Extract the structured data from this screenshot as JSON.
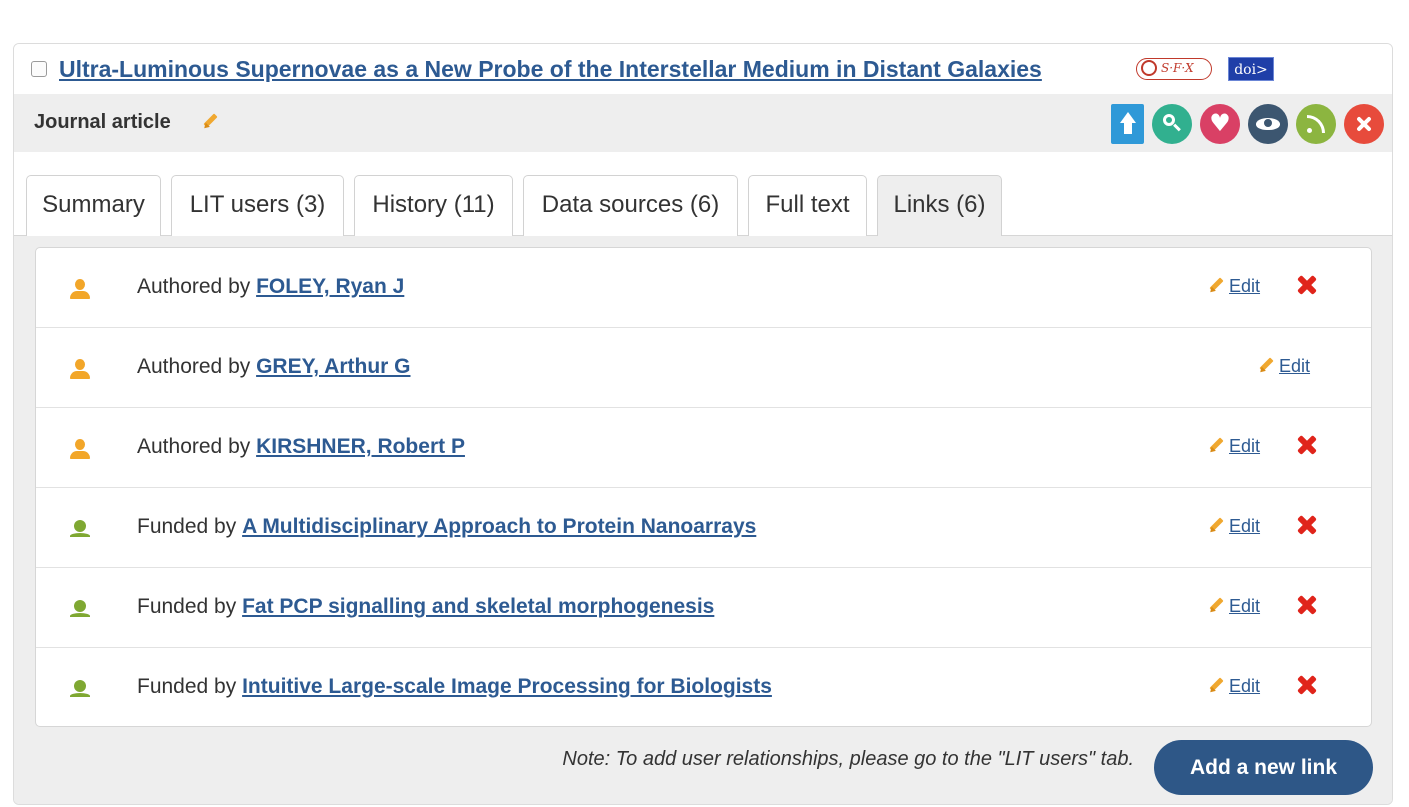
{
  "record": {
    "title": "Ultra-Luminous Supernovae as a New Probe of the Interstellar Medium in Distant Galaxies",
    "sfx_label": "S·F·X",
    "doi_label": "doi>",
    "type_label": "Journal article"
  },
  "actions": [
    {
      "icon": "upload-icon",
      "color": "#2f99d8"
    },
    {
      "icon": "search-icon",
      "color": "#31b08f"
    },
    {
      "icon": "heart-icon",
      "color": "#d94065"
    },
    {
      "icon": "eye-icon",
      "color": "#3c5670"
    },
    {
      "icon": "feed-icon",
      "color": "#8cb540"
    },
    {
      "icon": "close-icon",
      "color": "#e74b3c"
    }
  ],
  "tabs": [
    {
      "label": "Summary"
    },
    {
      "label": "LIT users (3)"
    },
    {
      "label": "History (11)"
    },
    {
      "label": "Data sources (6)"
    },
    {
      "label": "Full text"
    },
    {
      "label": "Links (6)",
      "active": true
    }
  ],
  "links": [
    {
      "icon": "user-icon",
      "prefix": "Authored by",
      "target": "FOLEY, Ryan J",
      "edit": "Edit",
      "deletable": true
    },
    {
      "icon": "user-icon",
      "prefix": "Authored by",
      "target": "GREY, Arthur G",
      "edit": "Edit",
      "deletable": false
    },
    {
      "icon": "user-icon",
      "prefix": "Authored by",
      "target": "KIRSHNER, Robert P",
      "edit": "Edit",
      "deletable": true
    },
    {
      "icon": "funding-icon",
      "prefix": "Funded by",
      "target": "A Multidisciplinary Approach to Protein Nanoarrays",
      "edit": "Edit",
      "deletable": true
    },
    {
      "icon": "funding-icon",
      "prefix": "Funded by",
      "target": "Fat PCP signalling and skeletal morphogenesis",
      "edit": "Edit",
      "deletable": true
    },
    {
      "icon": "funding-icon",
      "prefix": "Funded by",
      "target": "Intuitive Large-scale Image Processing for Biologists",
      "edit": "Edit",
      "deletable": true
    }
  ],
  "footer": {
    "note": "Note: To add user relationships, please go to the \"LIT users\" tab.",
    "add_button": "Add a new link"
  },
  "colors": {
    "link": "#2d5a92",
    "button": "#2e5787",
    "delete": "#e0241b"
  }
}
